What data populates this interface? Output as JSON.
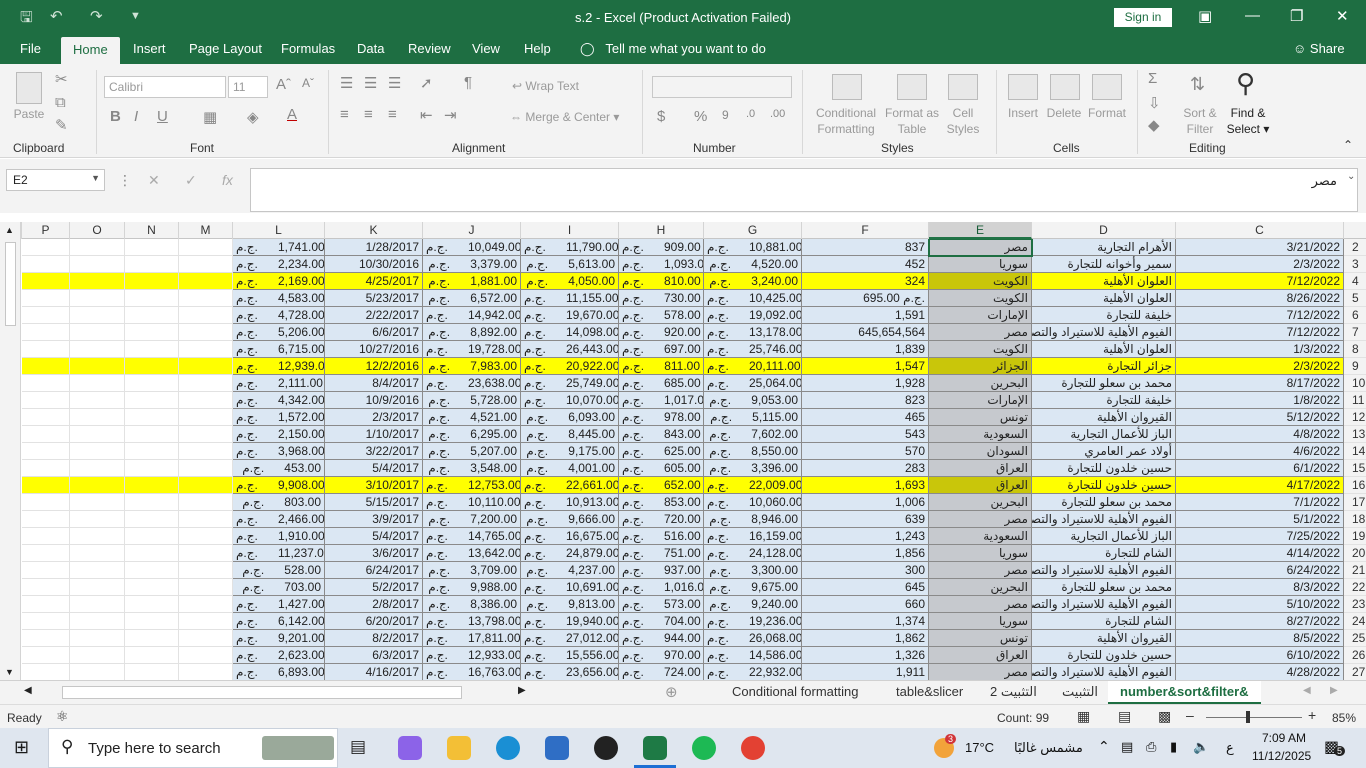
{
  "titlebar": {
    "title": "s.2  -  Excel (Product Activation Failed)",
    "signin": "Sign in"
  },
  "menu": {
    "tabs": [
      "File",
      "Home",
      "Insert",
      "Page Layout",
      "Formulas",
      "Data",
      "Review",
      "View",
      "Help"
    ],
    "tell": "Tell me what you want to do",
    "share": "Share"
  },
  "ribbon": {
    "paste": "Paste",
    "clipboard": "Clipboard",
    "font_name": "Calibri",
    "font_size": "11",
    "font": "Font",
    "wrap": "Wrap Text",
    "merge": "Merge & Center",
    "alignment": "Alignment",
    "number": "Number",
    "cond1": "Conditional",
    "cond2": "Formatting",
    "fmt1": "Format as",
    "fmt2": "Table",
    "cs1": "Cell",
    "cs2": "Styles",
    "styles": "Styles",
    "insert": "Insert",
    "delete": "Delete",
    "format": "Format",
    "cells": "Cells",
    "sort1": "Sort &",
    "sort2": "Filter",
    "find1": "Find &",
    "find2": "Select",
    "editing": "Editing"
  },
  "formula_bar": {
    "name_box": "E2",
    "fx": "fx",
    "value": "مصر"
  },
  "columns": [
    "P",
    "O",
    "N",
    "M",
    "L",
    "K",
    "J",
    "I",
    "H",
    "G",
    "F",
    "E",
    "D",
    "C"
  ],
  "currency": "ج.م.",
  "rows": [
    {
      "n": "2",
      "y": false,
      "L": "1,741.00",
      "K": "1/28/2017",
      "J": "10,049.00",
      "I": "11,790.00",
      "H": "909.00",
      "G": "10,881.00",
      "F": "837",
      "E": "مصر",
      "D": "الأهرام التجارية",
      "C": "3/21/2022"
    },
    {
      "n": "3",
      "y": false,
      "L": "2,234.00",
      "K": "10/30/2016",
      "J": "3,379.00",
      "I": "5,613.00",
      "H": "1,093.00",
      "G": "4,520.00",
      "F": "452",
      "E": "سوريا",
      "D": "سمير وأخوانه للتجارة",
      "C": "2/3/2022"
    },
    {
      "n": "4",
      "y": true,
      "L": "2,169.00",
      "K": "4/25/2017",
      "J": "1,881.00",
      "I": "4,050.00",
      "H": "810.00",
      "G": "3,240.00",
      "F": "324",
      "E": "الكويت",
      "D": "العلوان الأهلية",
      "C": "7/12/2022"
    },
    {
      "n": "5",
      "y": false,
      "L": "4,583.00",
      "K": "5/23/2017",
      "J": "6,572.00",
      "I": "11,155.00",
      "H": "730.00",
      "G": "10,425.00",
      "F": "695.00 ج.م.",
      "E": "الكويت",
      "D": "العلوان الأهلية",
      "C": "8/26/2022"
    },
    {
      "n": "6",
      "y": false,
      "L": "4,728.00",
      "K": "2/22/2017",
      "J": "14,942.00",
      "I": "19,670.00",
      "H": "578.00",
      "G": "19,092.00",
      "F": "1,591",
      "E": "الإمارات",
      "D": "خليفة للتجارة",
      "C": "7/12/2022"
    },
    {
      "n": "7",
      "y": false,
      "L": "5,206.00",
      "K": "6/6/2017",
      "J": "8,892.00",
      "I": "14,098.00",
      "H": "920.00",
      "G": "13,178.00",
      "F": "645,654,564",
      "E": "مصر",
      "D": "الفيوم الأهلية للاستيراد والتصدير",
      "C": "7/12/2022"
    },
    {
      "n": "8",
      "y": false,
      "L": "6,715.00",
      "K": "10/27/2016",
      "J": "19,728.00",
      "I": "26,443.00",
      "H": "697.00",
      "G": "25,746.00",
      "F": "1,839",
      "E": "الكويت",
      "D": "العلوان الأهلية",
      "C": "1/3/2022"
    },
    {
      "n": "9",
      "y": true,
      "L": "12,939.00",
      "K": "12/2/2016",
      "J": "7,983.00",
      "I": "20,922.00",
      "H": "811.00",
      "G": "20,111.00",
      "F": "1,547",
      "E": "الجزائر",
      "D": "جزائر التجارة",
      "C": "2/3/2022"
    },
    {
      "n": "10",
      "y": false,
      "L": "2,111.00",
      "K": "8/4/2017",
      "J": "23,638.00",
      "I": "25,749.00",
      "H": "685.00",
      "G": "25,064.00",
      "F": "1,928",
      "E": "البحرين",
      "D": "محمد بن سعلو للتجارة",
      "C": "8/17/2022"
    },
    {
      "n": "11",
      "y": false,
      "L": "4,342.00",
      "K": "10/9/2016",
      "J": "5,728.00",
      "I": "10,070.00",
      "H": "1,017.00",
      "G": "9,053.00",
      "F": "823",
      "E": "الإمارات",
      "D": "خليفة للتجارة",
      "C": "1/8/2022"
    },
    {
      "n": "12",
      "y": false,
      "L": "1,572.00",
      "K": "2/3/2017",
      "J": "4,521.00",
      "I": "6,093.00",
      "H": "978.00",
      "G": "5,115.00",
      "F": "465",
      "E": "تونس",
      "D": "القيروان الأهلية",
      "C": "5/12/2022"
    },
    {
      "n": "13",
      "y": false,
      "L": "2,150.00",
      "K": "1/10/2017",
      "J": "6,295.00",
      "I": "8,445.00",
      "H": "843.00",
      "G": "7,602.00",
      "F": "543",
      "E": "السعودية",
      "D": "الباز للأعمال التجارية",
      "C": "4/8/2022"
    },
    {
      "n": "14",
      "y": false,
      "L": "3,968.00",
      "K": "3/22/2017",
      "J": "5,207.00",
      "I": "9,175.00",
      "H": "625.00",
      "G": "8,550.00",
      "F": "570",
      "E": "السودان",
      "D": "أولاد عمر العامري",
      "C": "4/6/2022"
    },
    {
      "n": "15",
      "y": false,
      "L": "453.00",
      "K": "5/4/2017",
      "J": "3,548.00",
      "I": "4,001.00",
      "H": "605.00",
      "G": "3,396.00",
      "F": "283",
      "E": "العراق",
      "D": "حسين خلدون للتجارة",
      "C": "6/1/2022"
    },
    {
      "n": "16",
      "y": true,
      "L": "9,908.00",
      "K": "3/10/2017",
      "J": "12,753.00",
      "I": "22,661.00",
      "H": "652.00",
      "G": "22,009.00",
      "F": "1,693",
      "E": "العراق",
      "D": "حسين خلدون للتجارة",
      "C": "4/17/2022"
    },
    {
      "n": "17",
      "y": false,
      "L": "803.00",
      "K": "5/15/2017",
      "J": "10,110.00",
      "I": "10,913.00",
      "H": "853.00",
      "G": "10,060.00",
      "F": "1,006",
      "E": "البحرين",
      "D": "محمد بن سعلو للتجارة",
      "C": "7/1/2022"
    },
    {
      "n": "18",
      "y": false,
      "L": "2,466.00",
      "K": "3/9/2017",
      "J": "7,200.00",
      "I": "9,666.00",
      "H": "720.00",
      "G": "8,946.00",
      "F": "639",
      "E": "مصر",
      "D": "الفيوم الأهلية للاستيراد والتصدير",
      "C": "5/1/2022"
    },
    {
      "n": "19",
      "y": false,
      "L": "1,910.00",
      "K": "5/4/2017",
      "J": "14,765.00",
      "I": "16,675.00",
      "H": "516.00",
      "G": "16,159.00",
      "F": "1,243",
      "E": "السعودية",
      "D": "الباز للأعمال التجارية",
      "C": "7/25/2022"
    },
    {
      "n": "20",
      "y": false,
      "L": "11,237.00",
      "K": "3/6/2017",
      "J": "13,642.00",
      "I": "24,879.00",
      "H": "751.00",
      "G": "24,128.00",
      "F": "1,856",
      "E": "سوريا",
      "D": "الشام للتجارة",
      "C": "4/14/2022"
    },
    {
      "n": "21",
      "y": false,
      "L": "528.00",
      "K": "6/24/2017",
      "J": "3,709.00",
      "I": "4,237.00",
      "H": "937.00",
      "G": "3,300.00",
      "F": "300",
      "E": "مصر",
      "D": "الفيوم الأهلية للاستيراد والتصدير",
      "C": "6/24/2022"
    },
    {
      "n": "22",
      "y": false,
      "L": "703.00",
      "K": "5/2/2017",
      "J": "9,988.00",
      "I": "10,691.00",
      "H": "1,016.00",
      "G": "9,675.00",
      "F": "645",
      "E": "البحرين",
      "D": "محمد بن سعلو للتجارة",
      "C": "8/3/2022"
    },
    {
      "n": "23",
      "y": false,
      "L": "1,427.00",
      "K": "2/8/2017",
      "J": "8,386.00",
      "I": "9,813.00",
      "H": "573.00",
      "G": "9,240.00",
      "F": "660",
      "E": "مصر",
      "D": "الفيوم الأهلية للاستيراد والتصدير",
      "C": "5/10/2022"
    },
    {
      "n": "24",
      "y": false,
      "L": "6,142.00",
      "K": "6/20/2017",
      "J": "13,798.00",
      "I": "19,940.00",
      "H": "704.00",
      "G": "19,236.00",
      "F": "1,374",
      "E": "سوريا",
      "D": "الشام للتجارة",
      "C": "8/27/2022"
    },
    {
      "n": "25",
      "y": false,
      "L": "9,201.00",
      "K": "8/2/2017",
      "J": "17,811.00",
      "I": "27,012.00",
      "H": "944.00",
      "G": "26,068.00",
      "F": "1,862",
      "E": "تونس",
      "D": "القيروان الأهلية",
      "C": "8/5/2022"
    },
    {
      "n": "26",
      "y": false,
      "L": "2,623.00",
      "K": "6/3/2017",
      "J": "12,933.00",
      "I": "15,556.00",
      "H": "970.00",
      "G": "14,586.00",
      "F": "1,326",
      "E": "العراق",
      "D": "حسين خلدون للتجارة",
      "C": "6/10/2022"
    },
    {
      "n": "27",
      "y": false,
      "L": "6,893.00",
      "K": "4/16/2017",
      "J": "16,763.00",
      "I": "23,656.00",
      "H": "724.00",
      "G": "22,932.00",
      "F": "1,911",
      "E": "مصر",
      "D": "الفيوم الأهلية للاستيراد والتصدير",
      "C": "4/28/2022"
    }
  ],
  "sheets": [
    "Conditional formatting",
    "table&slicer",
    "التثبيت 2",
    "التثبيت",
    "number&sort&filter&"
  ],
  "status": {
    "ready": "Ready",
    "count": "Count: 99",
    "zoom": "85%"
  },
  "taskbar": {
    "search": "Type here to search",
    "temp": "17°C",
    "weather": "مشمس غالبًا",
    "badge": "3",
    "lang": "ع",
    "time": "7:09 AM",
    "date": "11/12/2025",
    "notif": "5"
  }
}
